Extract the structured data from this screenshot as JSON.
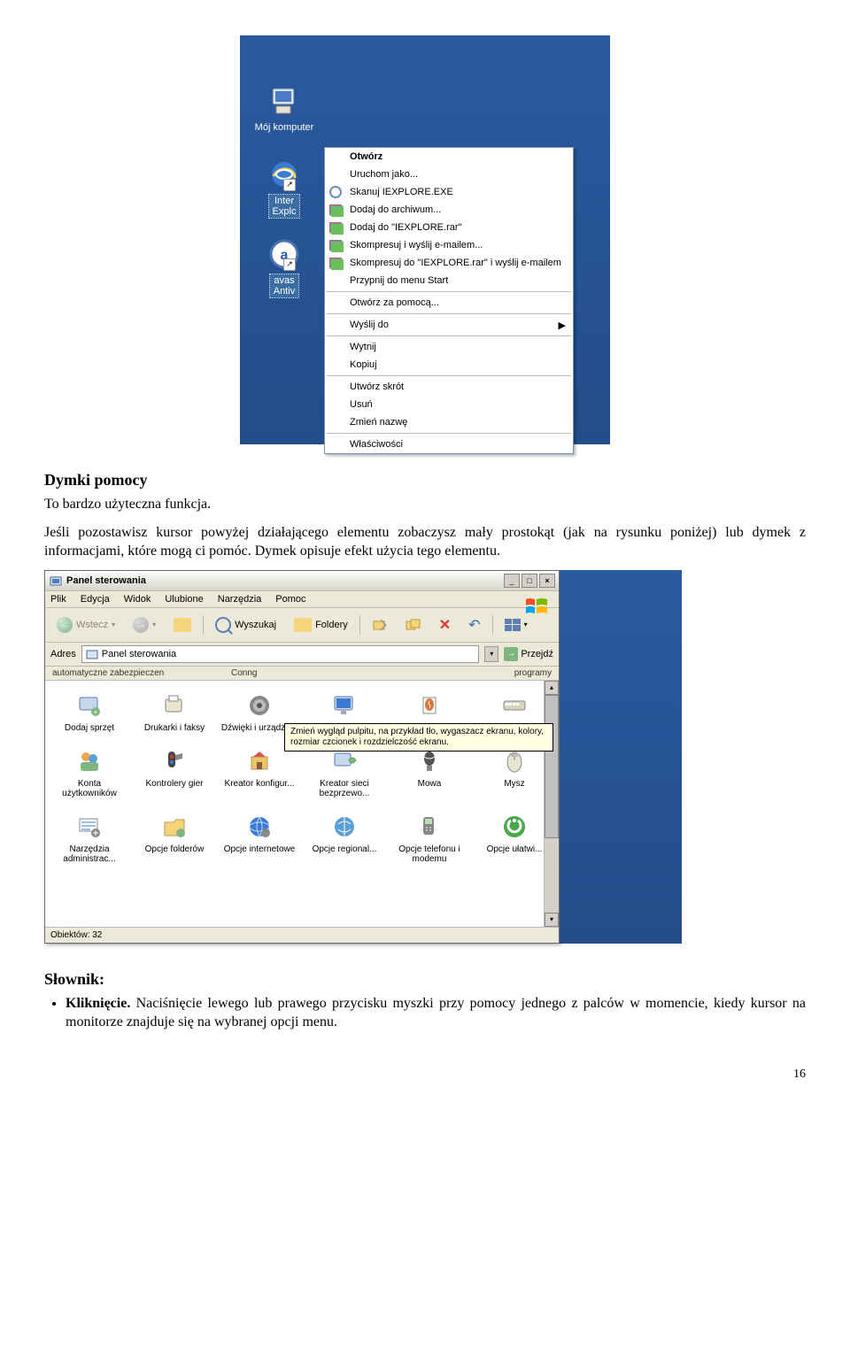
{
  "screenshot1": {
    "icons": {
      "mycomputer": "Mój komputer",
      "ie_line1": "Inter",
      "ie_line2": "Explc",
      "avast_line1": "avas",
      "avast_line2": "Antiv"
    },
    "menu": {
      "otworz": "Otwórz",
      "uruchom_jako": "Uruchom jako...",
      "skanuj": "Skanuj IEXPLORE.EXE",
      "dodaj_archiwum": "Dodaj do archiwum...",
      "dodaj_iexplore": "Dodaj do \"IEXPLORE.rar\"",
      "skompresuj_mail": "Skompresuj i wyślij e-mailem...",
      "skompresuj_iexp": "Skompresuj do \"IEXPLORE.rar\" i wyślij e-mailem",
      "przypnij": "Przypnij do menu Start",
      "otworz_za": "Otwórz za pomocą...",
      "wyslij_do": "Wyślij do",
      "wytnij": "Wytnij",
      "kopiuj": "Kopiuj",
      "utworz_skrot": "Utwórz skrót",
      "usun": "Usuń",
      "zmien_nazwe": "Zmień nazwę",
      "wlasciwosci": "Właściwości"
    }
  },
  "text": {
    "h_dymki": "Dymki pomocy",
    "p_dymki1": "To bardzo użyteczna funkcja.",
    "p_dymki2": "Jeśli pozostawisz kursor powyżej działającego elementu zobaczysz mały prostokąt (jak na rysunku poniżej) lub dymek z informacjami, które mogą ci pomóc. Dymek opisuje efekt użycia tego elementu.",
    "h_slownik": "Słownik:",
    "bullet_klik_b": "Kliknięcie.",
    "bullet_klik": " Naciśnięcie lewego lub prawego przycisku myszki przy pomocy jednego z palców w momencie, kiedy kursor na monitorze znajduje się na wybranej opcji menu.",
    "page": "16"
  },
  "cp": {
    "title": "Panel sterowania",
    "menubar": [
      "Plik",
      "Edycja",
      "Widok",
      "Ulubione",
      "Narzędzia",
      "Pomoc"
    ],
    "toolbar": {
      "wstecz": "Wstecz",
      "wyszukaj": "Wyszukaj",
      "foldery": "Foldery"
    },
    "address_label": "Adres",
    "address_value": "Panel sterowania",
    "go": "Przejdź",
    "partial_left": "automatyczne  zabezpieczen",
    "partial_mid": "Conng",
    "partial_right": "programy",
    "items": [
      "Dodaj sprzęt",
      "Drukarki i faksy",
      "Dźwięki i urządze...",
      "Ekran",
      "Java",
      "Klawiatura",
      "Konta użytkowników",
      "Kontrolery gier",
      "Kreator konfigur...",
      "Kreator sieci bezprzewo...",
      "Mowa",
      "Mysz",
      "Narzędzia administrac...",
      "Opcje folderów",
      "Opcje internetowe",
      "Opcje regional...",
      "Opcje telefonu i modemu",
      "Opcje ułatwi..."
    ],
    "tooltip": "Zmień wygląd pulpitu, na przykład tło, wygaszacz ekranu, kolory, rozmiar czcionek i rozdzielczość ekranu.",
    "status": "Obiektów: 32"
  }
}
